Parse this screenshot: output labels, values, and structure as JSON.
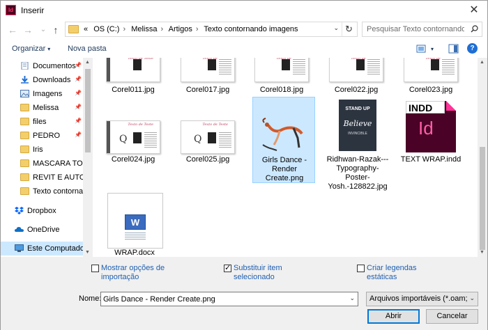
{
  "window": {
    "title": "Inserir",
    "close_glyph": "✕",
    "app_icon_text": "Id"
  },
  "nav": {
    "back_glyph": "←",
    "forward_glyph": "→",
    "up_glyph": "↑",
    "recent_glyph": "⌄",
    "address_prefix": "«",
    "breadcrumb": [
      "OS (C:)",
      "Melissa",
      "Artigos",
      "Texto contornando imagens"
    ],
    "refresh_glyph": "↻",
    "dropdown_glyph": "⌄",
    "search_placeholder": "Pesquisar Texto contornando ..."
  },
  "toolbar": {
    "organize_label": "Organizar",
    "organize_caret": "▾",
    "new_folder_label": "Nova pasta",
    "view_caret": "▾",
    "help_glyph": "?"
  },
  "sidebar": {
    "pin_glyph": "📌",
    "items": [
      {
        "label": "Documentos",
        "icon": "documents-icon",
        "pinned": true
      },
      {
        "label": "Downloads",
        "icon": "downloads-icon",
        "pinned": true
      },
      {
        "label": "Imagens",
        "icon": "pictures-icon",
        "pinned": true
      },
      {
        "label": "Melissa",
        "icon": "folder-icon",
        "pinned": true
      },
      {
        "label": "files",
        "icon": "folder-icon",
        "pinned": true
      },
      {
        "label": "PEDRO",
        "icon": "folder-icon",
        "pinned": true
      },
      {
        "label": "Iris",
        "icon": "folder-icon",
        "pinned": false
      },
      {
        "label": "MASCARA TOP",
        "icon": "folder-icon",
        "pinned": false
      },
      {
        "label": "REVIT E AUTOCA",
        "icon": "folder-icon",
        "pinned": false
      },
      {
        "label": "Texto contornan",
        "icon": "folder-icon",
        "pinned": false
      },
      {
        "label": "Dropbox",
        "icon": "dropbox-icon",
        "pinned": false
      },
      {
        "label": "OneDrive",
        "icon": "onedrive-icon",
        "pinned": false
      },
      {
        "label": "Este Computador",
        "icon": "computer-icon",
        "pinned": false
      }
    ]
  },
  "files": {
    "row1": [
      {
        "name": "Corel011.jpg"
      },
      {
        "name": "Corel017.jpg"
      },
      {
        "name": "Corel018.jpg"
      },
      {
        "name": "Corel022.jpg"
      },
      {
        "name": "Corel023.jpg"
      }
    ],
    "row2": [
      {
        "name": "Corel024.jpg"
      },
      {
        "name": "Corel025.jpg"
      },
      {
        "name": "Girls Dance - Render Create.png",
        "selected": true
      },
      {
        "name": "Ridhwan-Razak---Typography-Poster-Yosh.-128822.jpg"
      },
      {
        "name": "TEXT WRAP.indd"
      }
    ],
    "row3": [
      {
        "name": "WRAP.docx"
      }
    ],
    "thumb_header_text": "Texto de Teste",
    "thumb_q": "Q",
    "poster_lines": [
      "STAND UP",
      "Believe",
      "INVINCIBLE"
    ],
    "indd_tag": "INDD",
    "indd_letters": "Id"
  },
  "options": {
    "show_import": {
      "label": "Mostrar opções de importação",
      "checked": false
    },
    "replace_selected": {
      "label": "Substituir item selecionado",
      "checked": true
    },
    "create_captions": {
      "label": "Criar legendas estáticas",
      "checked": false
    }
  },
  "filename": {
    "label": "Nome:",
    "value": "Girls Dance - Render Create.png",
    "dropdown_glyph": "⌄"
  },
  "filetype": {
    "value": "Arquivos importáveis (*.oam;*.i",
    "dropdown_glyph": "⌄"
  },
  "buttons": {
    "open": "Abrir",
    "cancel": "Cancelar"
  },
  "colors": {
    "selection": "#cce8ff",
    "link": "#1f5fb0",
    "accent": "#0078d7",
    "indesign": "#ff3366"
  }
}
